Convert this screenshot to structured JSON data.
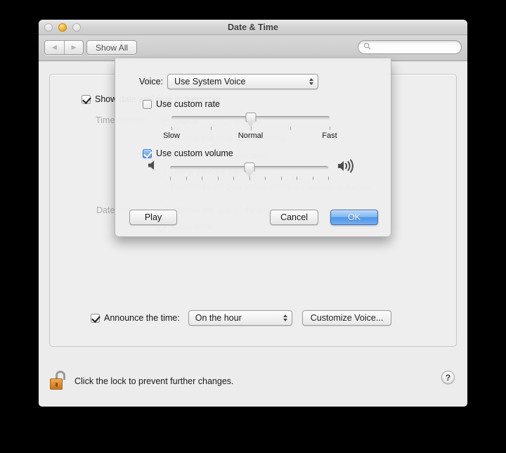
{
  "window": {
    "title": "Date & Time",
    "traffic_lights": [
      "close",
      "minimize",
      "zoom"
    ],
    "toolbar": {
      "back_label": "◀",
      "forward_label": "▶",
      "show_all_label": "Show All",
      "search_placeholder": "",
      "search_value": ""
    }
  },
  "background": {
    "show_date_time_menu_bar": {
      "label": "Show date and time in menu bar",
      "checked": true
    },
    "time_options_label": "Time options:",
    "time_options": [
      {
        "label": "Digital",
        "selected": true
      },
      {
        "label": "Analog",
        "selected": false
      }
    ],
    "sub_options": [
      {
        "label": "Display the time with seconds",
        "checked": false
      },
      {
        "label": "Flash the time separators",
        "checked": false
      },
      {
        "label": "Use a 24-hour clock",
        "checked": false
      }
    ],
    "disabled_note": "Disabled by the Date format setting in Language & Region",
    "date_options_label": "Date options:",
    "date_options": [
      {
        "label": "Show the day of the week",
        "checked": true
      },
      {
        "label": "Show date",
        "checked": true
      }
    ],
    "announce": {
      "label": "Announce the time:",
      "checked": true,
      "popup_value": "On the hour",
      "customize_button": "Customize Voice..."
    },
    "footer": {
      "lock_text": "Click the lock to prevent further changes.",
      "lock_state": "unlocked",
      "help_label": "?"
    }
  },
  "sheet": {
    "voice": {
      "label": "Voice:",
      "value": "Use System Voice"
    },
    "rate": {
      "checkbox_label": "Use custom rate",
      "checked": false,
      "min_label": "Slow",
      "mid_label": "Normal",
      "max_label": "Fast",
      "value_percent": 50
    },
    "volume": {
      "checkbox_label": "Use custom volume",
      "checked": true,
      "value_percent": 50,
      "min_icon": "speaker-low-icon",
      "max_icon": "speaker-high-icon"
    },
    "buttons": {
      "play": "Play",
      "cancel": "Cancel",
      "ok": "OK"
    }
  },
  "colors": {
    "accent_blue": "#4e95e8",
    "checkbox_blue": "#5a9de4",
    "lock_orange": "#dd8f31",
    "window_bg": "#ececec"
  }
}
